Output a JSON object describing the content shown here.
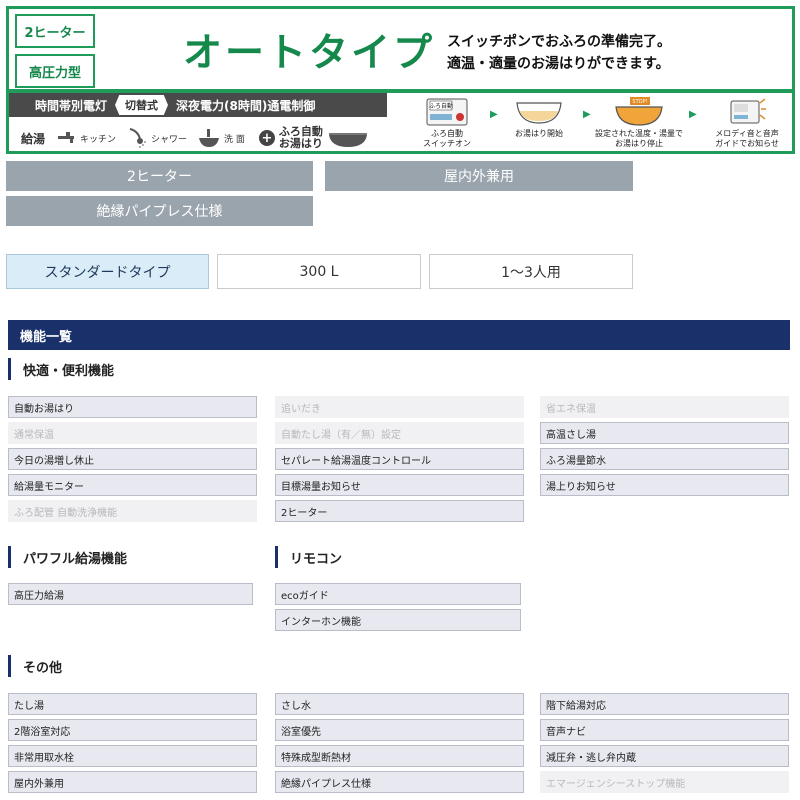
{
  "banner": {
    "tag_heater": "2ヒーター",
    "tag_pressure": "高圧力型",
    "title": "オートタイプ",
    "catch_line1": "スイッチポンでおふろの準備完了。",
    "catch_line2": "適温・適量のお湯はりができます。",
    "power_left": "時間帯別電灯",
    "power_switch": "切替式",
    "power_right": "深夜電力(8時間)通電制御",
    "supply_label": "給湯",
    "kitchen": "キッチン",
    "shower": "シャワー",
    "sink": "洗 面",
    "furo_line1": "ふろ自動",
    "furo_line2": "お湯はり",
    "step1_panel": "ふろ自動",
    "step1_line1": "ふろ自動",
    "step1_line2": "スイッチオン",
    "step2": "お湯はり開始",
    "step3_stop": "STOP!",
    "step3_line1": "設定された温度・湯量で",
    "step3_line2": "お湯はり停止",
    "step4_line1": "メロディ音と音声",
    "step4_line2": "ガイドでお知らせ"
  },
  "tags": [
    "2ヒーター",
    "屋内外兼用",
    "絶縁パイプレス仕様"
  ],
  "spec_boxes": [
    "スタンダードタイプ",
    "300 L",
    "1～3人用"
  ],
  "functions_title": "機能一覧",
  "sections": {
    "comfort": {
      "title": "快適・便利機能",
      "items": [
        {
          "label": "自動お湯はり",
          "on": true
        },
        {
          "label": "追いだき",
          "on": false
        },
        {
          "label": "省エネ保温",
          "on": false
        },
        {
          "label": "通常保温",
          "on": false
        },
        {
          "label": "自動たし湯（有／無）設定",
          "on": false
        },
        {
          "label": "高温さし湯",
          "on": true
        },
        {
          "label": "今日の湯増し休止",
          "on": true
        },
        {
          "label": "セパレート給湯温度コントロール",
          "on": true
        },
        {
          "label": "ふろ湯量節水",
          "on": true
        },
        {
          "label": "給湯量モニター",
          "on": true
        },
        {
          "label": "目標湯量お知らせ",
          "on": true
        },
        {
          "label": "湯上りお知らせ",
          "on": true
        },
        {
          "label": "ふろ配管 自動洗浄機能",
          "on": false
        },
        {
          "label": "2ヒーター",
          "on": true
        }
      ]
    },
    "powerful": {
      "title": "パワフル給湯機能",
      "items": [
        {
          "label": "高圧力給湯",
          "on": true
        }
      ]
    },
    "remote": {
      "title": "リモコン",
      "items": [
        {
          "label": "ecoガイド",
          "on": true
        },
        {
          "label": "インターホン機能",
          "on": true
        }
      ]
    },
    "other": {
      "title": "その他",
      "items": [
        {
          "label": "たし湯",
          "on": true
        },
        {
          "label": "さし水",
          "on": true
        },
        {
          "label": "階下給湯対応",
          "on": true
        },
        {
          "label": "2階浴室対応",
          "on": true
        },
        {
          "label": "浴室優先",
          "on": true
        },
        {
          "label": "音声ナビ",
          "on": true
        },
        {
          "label": "非常用取水栓",
          "on": true
        },
        {
          "label": "特殊成型断熱材",
          "on": true
        },
        {
          "label": "減圧弁・逃し弁内蔵",
          "on": true
        },
        {
          "label": "屋内外兼用",
          "on": true
        },
        {
          "label": "絶縁パイプレス仕様",
          "on": true
        },
        {
          "label": "エマージェンシーストップ機能",
          "on": false
        }
      ]
    }
  },
  "colors": {
    "brand_green": "#1f9b5a",
    "navy": "#19306a",
    "tag_gray": "#9aa4ad",
    "active_fill": "#e7e8f0",
    "inactive_text": "#b8b8bc",
    "highlight_blue": "#d9ecf7"
  }
}
